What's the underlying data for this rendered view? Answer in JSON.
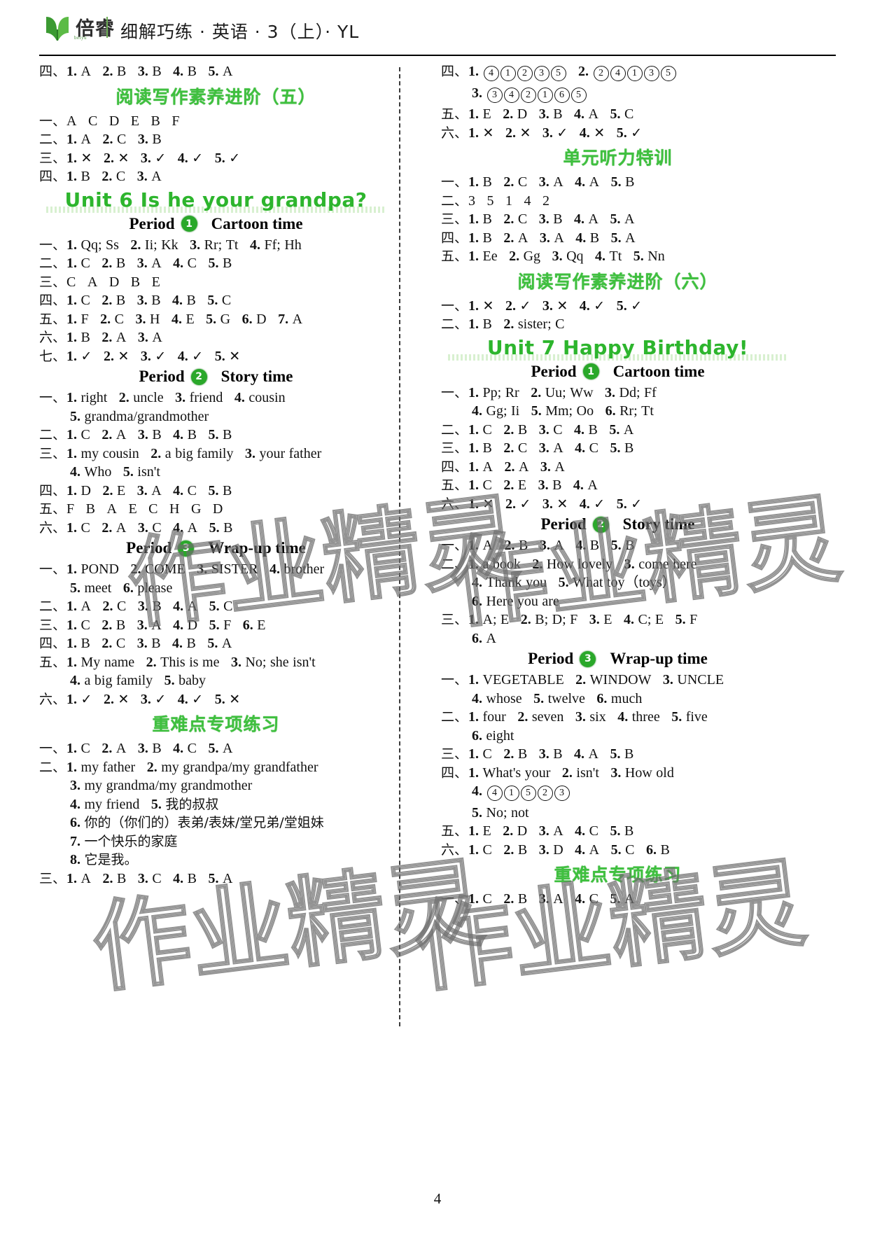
{
  "header": {
    "brand_cn": "倍睿",
    "brand_sub": "beiyu",
    "title": "细解巧练 · 英语 · 3（上）· YL"
  },
  "page_number": "4",
  "watermark": "作业精灵",
  "colors": {
    "heading_green": "#3fc03f",
    "unit_green": "#2db52d",
    "badge_green": "#2aa82a"
  },
  "left_column": [
    {
      "type": "line",
      "cn": "四",
      "parts": "1. A   2. B   3. B   4. B   5. A"
    },
    {
      "type": "sec",
      "text": "阅读写作素养进阶（五）"
    },
    {
      "type": "line",
      "cn": "一",
      "parts": "A   C   D   E   B   F"
    },
    {
      "type": "line",
      "cn": "二",
      "parts": "1. A   2. C   3. B"
    },
    {
      "type": "line",
      "cn": "三",
      "parts": "1. ×   2. ×   3. √   4. √   5. √"
    },
    {
      "type": "line",
      "cn": "四",
      "parts": "1. B   2. C   3. A"
    },
    {
      "type": "unit",
      "text": "Unit 6  Is he your grandpa?"
    },
    {
      "type": "period",
      "word": "Period",
      "num": "1",
      "name": "Cartoon time"
    },
    {
      "type": "line",
      "cn": "一",
      "parts": "1. Qq; Ss   2. Ii; Kk   3. Rr; Tt   4. Ff; Hh"
    },
    {
      "type": "line",
      "cn": "二",
      "parts": "1. C   2. B   3. A   4. C   5. B"
    },
    {
      "type": "line",
      "cn": "三",
      "parts": "C   A   D   B   E"
    },
    {
      "type": "line",
      "cn": "四",
      "parts": "1. C   2. B   3. B   4. B   5. C"
    },
    {
      "type": "line",
      "cn": "五",
      "parts": "1. F   2. C   3. H   4. E   5. G   6. D   7. A"
    },
    {
      "type": "line",
      "cn": "六",
      "parts": "1. B   2. A   3. A"
    },
    {
      "type": "line",
      "cn": "七",
      "parts": "1. √   2. ×   3. √   4. √   5. ×"
    },
    {
      "type": "period",
      "word": "Period",
      "num": "2",
      "name": "Story time"
    },
    {
      "type": "line",
      "cn": "一",
      "parts": "1. right   2. uncle   3. friend   4. cousin"
    },
    {
      "type": "cont",
      "parts": "5. grandma/grandmother"
    },
    {
      "type": "line",
      "cn": "二",
      "parts": "1. C   2. A   3. B   4. B   5. B"
    },
    {
      "type": "line",
      "cn": "三",
      "parts": "1. my cousin   2. a big family   3. your father"
    },
    {
      "type": "cont",
      "parts": "4. Who   5. isn't"
    },
    {
      "type": "line",
      "cn": "四",
      "parts": "1. D   2. E   3. A   4. C   5. B"
    },
    {
      "type": "line",
      "cn": "五",
      "parts": "F   B   A   E   C   H   G   D"
    },
    {
      "type": "line",
      "cn": "六",
      "parts": "1. C   2. A   3. C   4. A   5. B"
    },
    {
      "type": "period",
      "word": "Period",
      "num": "3",
      "name": "Wrap-up time"
    },
    {
      "type": "line",
      "cn": "一",
      "parts": "1. POND   2. COME   3. SISTER   4. brother"
    },
    {
      "type": "cont",
      "parts": "5. meet   6. please"
    },
    {
      "type": "line",
      "cn": "二",
      "parts": "1. A   2. C   3. B   4. A   5. C"
    },
    {
      "type": "line",
      "cn": "三",
      "parts": "1. C   2. B   3. A   4. D   5. F   6. E"
    },
    {
      "type": "line",
      "cn": "四",
      "parts": "1. B   2. C   3. B   4. B   5. A"
    },
    {
      "type": "line",
      "cn": "五",
      "parts": "1. My name   2. This is me   3. No; she isn't"
    },
    {
      "type": "cont",
      "parts": "4. a big family   5. baby"
    },
    {
      "type": "line",
      "cn": "六",
      "parts": "1. √   2. ×   3. √   4. √   5. ×"
    },
    {
      "type": "sec",
      "text": "重难点专项练习"
    },
    {
      "type": "line",
      "cn": "一",
      "parts": "1. C   2. A   3. B   4. C   5. A"
    },
    {
      "type": "line",
      "cn": "二",
      "parts": "1. my father   2. my grandpa/my grandfather"
    },
    {
      "type": "cont",
      "parts": "3. my grandma/my grandmother"
    },
    {
      "type": "cont",
      "parts": "4. my friend   5. 我的叔叔"
    },
    {
      "type": "cont",
      "parts": "6. 你的（你们的）表弟/表妹/堂兄弟/堂姐妹"
    },
    {
      "type": "cont",
      "parts": "7. 一个快乐的家庭"
    },
    {
      "type": "cont",
      "parts": "8. 它是我。"
    },
    {
      "type": "line",
      "cn": "三",
      "parts": "1. A   2. B   3. C   4. B   5. A"
    }
  ],
  "right_column": [
    {
      "type": "line",
      "cn": "四",
      "parts": "1. ④①②③⑤   2. ②④①③⑤"
    },
    {
      "type": "cont",
      "parts": "3. ③④②①⑥⑤"
    },
    {
      "type": "line",
      "cn": "五",
      "parts": "1. E   2. D   3. B   4. A   5. C"
    },
    {
      "type": "line",
      "cn": "六",
      "parts": "1. ×   2. ×   3. √   4. ×   5. √"
    },
    {
      "type": "sec",
      "text": "单元听力特训"
    },
    {
      "type": "line",
      "cn": "一",
      "parts": "1. B   2. C   3. A   4. A   5. B"
    },
    {
      "type": "line",
      "cn": "二",
      "parts": "3   5   1   4   2"
    },
    {
      "type": "line",
      "cn": "三",
      "parts": "1. B   2. C   3. B   4. A   5. A"
    },
    {
      "type": "line",
      "cn": "四",
      "parts": "1. B   2. A   3. A   4. B   5. A"
    },
    {
      "type": "line",
      "cn": "五",
      "parts": "1. Ee   2. Gg   3. Qq   4. Tt   5. Nn"
    },
    {
      "type": "sec",
      "text": "阅读写作素养进阶（六）"
    },
    {
      "type": "line",
      "cn": "一",
      "parts": "1. ×   2. √   3. ×   4. √   5. √"
    },
    {
      "type": "line",
      "cn": "二",
      "parts": "1. B   2. sister; C"
    },
    {
      "type": "unit",
      "text": "Unit 7  Happy Birthday!"
    },
    {
      "type": "period",
      "word": "Period",
      "num": "1",
      "name": "Cartoon time"
    },
    {
      "type": "line",
      "cn": "一",
      "parts": "1. Pp; Rr   2. Uu; Ww   3. Dd; Ff"
    },
    {
      "type": "cont",
      "parts": "4. Gg; Ii   5. Mm; Oo   6. Rr; Tt"
    },
    {
      "type": "line",
      "cn": "二",
      "parts": "1. C   2. B   3. C   4. B   5. A"
    },
    {
      "type": "line",
      "cn": "三",
      "parts": "1. B   2. C   3. A   4. C   5. B"
    },
    {
      "type": "line",
      "cn": "四",
      "parts": "1. A   2. A   3. A"
    },
    {
      "type": "line",
      "cn": "五",
      "parts": "1. C   2. E   3. B   4. A"
    },
    {
      "type": "line",
      "cn": "六",
      "parts": "1. ×   2. √   3. ×   4. √   5. √"
    },
    {
      "type": "period",
      "word": "Period",
      "num": "2",
      "name": "Story time"
    },
    {
      "type": "line",
      "cn": "一",
      "parts": "1. A   2. B   3. A   4. B   5. B"
    },
    {
      "type": "line",
      "cn": "二",
      "parts": "1. a book   2. How lovely   3. come here"
    },
    {
      "type": "cont",
      "parts": "4. Thank you   5. What toy（toys）"
    },
    {
      "type": "cont",
      "parts": "6. Here you are"
    },
    {
      "type": "line",
      "cn": "三",
      "parts": "1. A; E   2. B; D; F   3. E   4. C; E   5. F"
    },
    {
      "type": "cont",
      "parts": "6. A"
    },
    {
      "type": "period",
      "word": "Period",
      "num": "3",
      "name": "Wrap-up time"
    },
    {
      "type": "line",
      "cn": "一",
      "parts": "1. VEGETABLE   2. WINDOW   3. UNCLE"
    },
    {
      "type": "cont",
      "parts": "4. whose   5. twelve   6. much"
    },
    {
      "type": "line",
      "cn": "二",
      "parts": "1. four   2. seven   3. six   4. three   5. five"
    },
    {
      "type": "cont",
      "parts": "6. eight"
    },
    {
      "type": "line",
      "cn": "三",
      "parts": "1. C   2. B   3. B   4. A   5. B"
    },
    {
      "type": "line",
      "cn": "四",
      "parts": "1. What's your   2. isn't   3. How old"
    },
    {
      "type": "cont",
      "parts": "4. ④①⑤②③"
    },
    {
      "type": "cont",
      "parts": "5. No; not"
    },
    {
      "type": "line",
      "cn": "五",
      "parts": "1. E   2. D   3. A   4. C   5. B"
    },
    {
      "type": "line",
      "cn": "六",
      "parts": "1. C   2. B   3. D   4. A   5. C   6. B"
    },
    {
      "type": "sec",
      "text": "重难点专项练习"
    },
    {
      "type": "line",
      "cn": "一",
      "parts": "1. C   2. B   3. A   4. C   5. A"
    }
  ]
}
